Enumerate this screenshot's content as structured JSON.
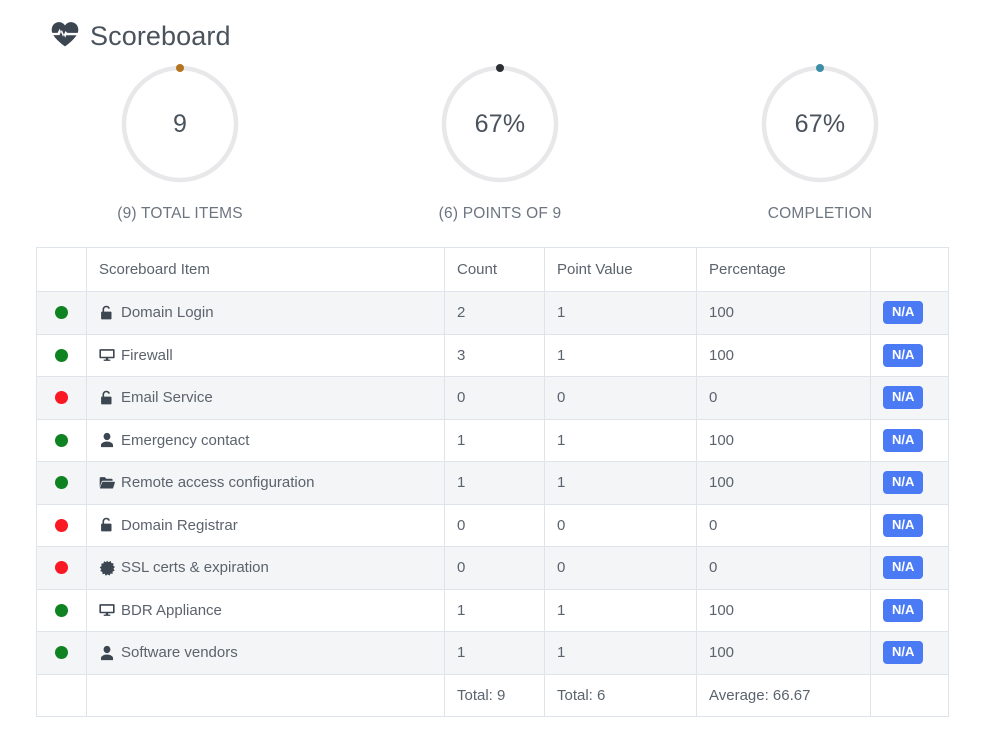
{
  "header": {
    "title": "Scoreboard",
    "icon": "heart-pulse-icon"
  },
  "gauges": [
    {
      "value": "9",
      "label": "(9) TOTAL ITEMS",
      "dot_color": "#b3751f",
      "ring_color": "#e8e8ea"
    },
    {
      "value": "67%",
      "label": "(6) POINTS OF 9",
      "dot_color": "#2b2f33",
      "ring_color": "#e8e8ea"
    },
    {
      "value": "67%",
      "label": "COMPLETION",
      "dot_color": "#3b8ea5",
      "ring_color": "#e8e8ea"
    }
  ],
  "table": {
    "columns": [
      "",
      "Scoreboard Item",
      "Count",
      "Point Value",
      "Percentage",
      ""
    ],
    "rows": [
      {
        "status": "green",
        "icon": "unlock-icon",
        "item": "Domain Login",
        "count": "2",
        "point_value": "1",
        "percentage": "100",
        "action": "N/A"
      },
      {
        "status": "green",
        "icon": "desktop-icon",
        "item": "Firewall",
        "count": "3",
        "point_value": "1",
        "percentage": "100",
        "action": "N/A"
      },
      {
        "status": "red",
        "icon": "unlock-icon",
        "item": "Email Service",
        "count": "0",
        "point_value": "0",
        "percentage": "0",
        "action": "N/A"
      },
      {
        "status": "green",
        "icon": "user-icon",
        "item": "Emergency contact",
        "count": "1",
        "point_value": "1",
        "percentage": "100",
        "action": "N/A"
      },
      {
        "status": "green",
        "icon": "folder-open-icon",
        "item": "Remote access configuration",
        "count": "1",
        "point_value": "1",
        "percentage": "100",
        "action": "N/A"
      },
      {
        "status": "red",
        "icon": "unlock-icon",
        "item": "Domain Registrar",
        "count": "0",
        "point_value": "0",
        "percentage": "0",
        "action": "N/A"
      },
      {
        "status": "red",
        "icon": "certificate-icon",
        "item": "SSL certs & expiration",
        "count": "0",
        "point_value": "0",
        "percentage": "0",
        "action": "N/A"
      },
      {
        "status": "green",
        "icon": "desktop-icon",
        "item": "BDR Appliance",
        "count": "1",
        "point_value": "1",
        "percentage": "100",
        "action": "N/A"
      },
      {
        "status": "green",
        "icon": "user-icon",
        "item": "Software vendors",
        "count": "1",
        "point_value": "1",
        "percentage": "100",
        "action": "N/A"
      }
    ],
    "footer": {
      "status": "",
      "item": "",
      "count": "Total: 9",
      "point_value": "Total: 6",
      "percentage": "Average: 66.67",
      "action": ""
    }
  },
  "colors": {
    "accent_blue": "#4a7bf5",
    "status_green": "#0f8222",
    "status_red": "#fa1823",
    "text": "#5b636d",
    "border": "#dfe3ea",
    "row_alt": "#f4f5f7"
  }
}
